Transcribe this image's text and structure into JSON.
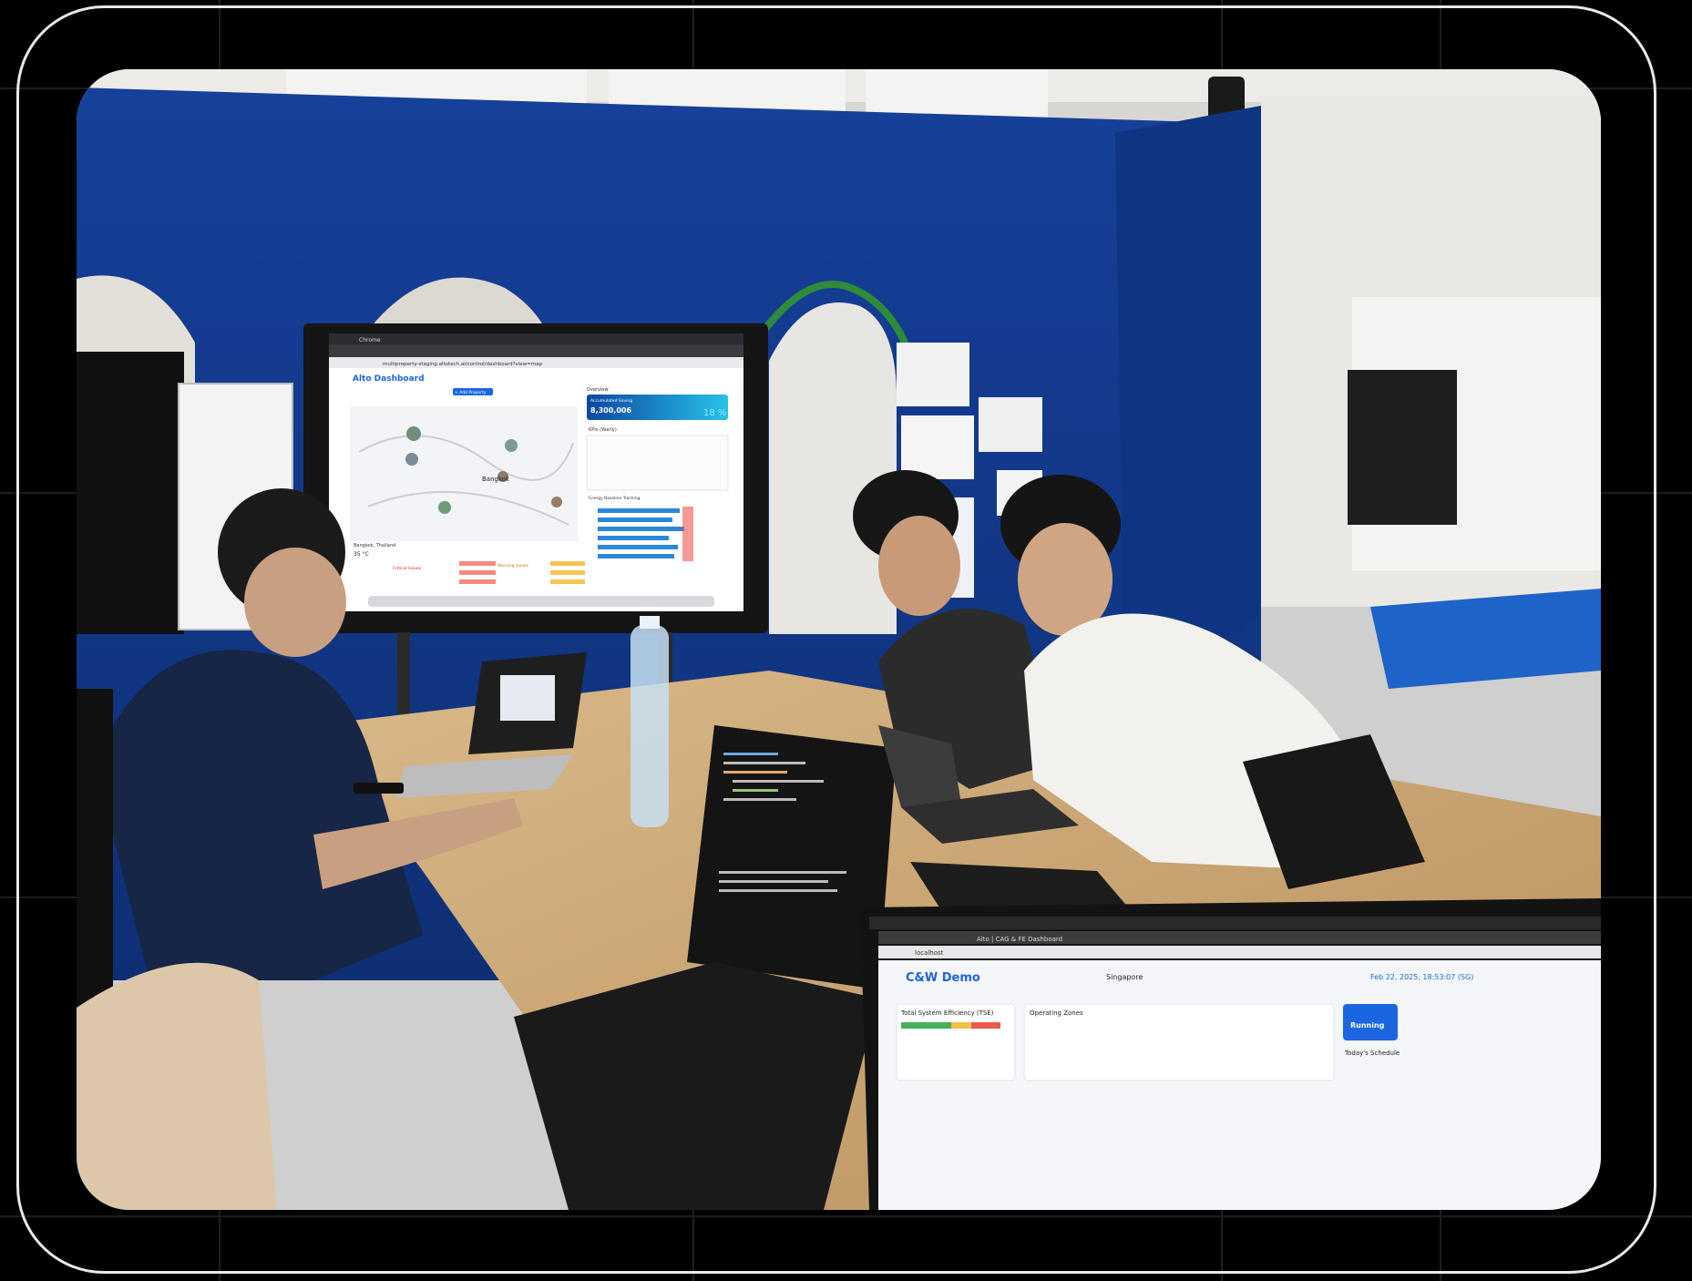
{
  "photo": {
    "scene": [],
    "main_screen": {
      "browser_app": "Chrome",
      "url": "multiproperty-staging.altotech.ai/control/dashboard?view=map",
      "dashboard_title": "Alto Dashboard",
      "add_property_button": "+ Add Property",
      "map_city_label": "Bangkok",
      "weather_location": "Bangkok, Thailand",
      "weather_temp": "35 °C",
      "overview_title": "Overview",
      "accumulated_saving_label": "Accumulated Saving",
      "accumulated_saving_value": "8,300,006",
      "saving_percent": "18 %",
      "kpis_title": "KPIs (Yearly)",
      "energy_baseline_title": "Energy Baseline Tracking",
      "critical_issues_title": "Critical Issues",
      "warning_issues_title": "Warning Issues"
    },
    "laptop_screen": {
      "tab_label": "Alto | CAG & FE Dashboard",
      "url": "localhost",
      "app_title": "C&W Demo",
      "location": "Singapore",
      "date_time": "Feb 22, 2025, 18:53:07 (SG)",
      "panel_tse": "Total System Efficiency (TSE)",
      "panel_operating_zones": "Operating Zones",
      "status_badge": "Running",
      "today_schedule": "Today's Schedule"
    }
  },
  "colors": {
    "wall_blue": "#123a8e",
    "screen_accent": "#1b66e0",
    "frame_border": "#e8e8e8"
  }
}
